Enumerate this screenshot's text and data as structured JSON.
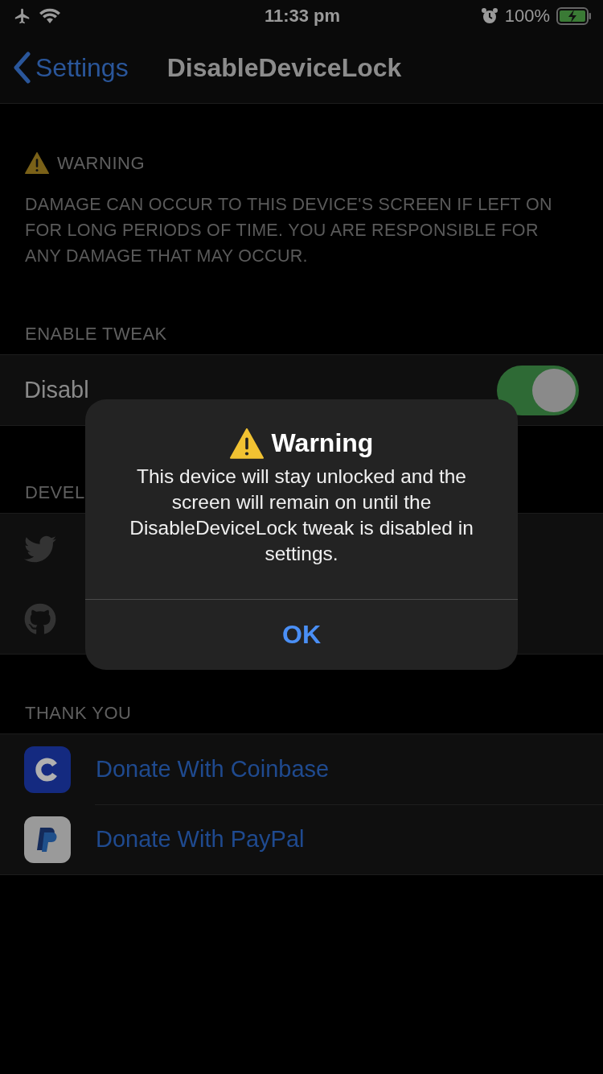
{
  "status_bar": {
    "time": "11:33 pm",
    "battery": "100%"
  },
  "nav": {
    "back": "Settings",
    "title": "DisableDeviceLock"
  },
  "sections": [
    {
      "kind": "warning",
      "header": "WARNING",
      "footer": "DAMAGE CAN OCCUR TO THIS DEVICE'S SCREEN IF LEFT ON FOR LONG PERIODS OF TIME. YOU ARE RESPONSIBLE FOR ANY DAMAGE THAT MAY OCCUR."
    },
    {
      "kind": "toggle",
      "header": "ENABLE TWEAK",
      "rows": [
        {
          "label": "Disabl",
          "on": true
        }
      ]
    },
    {
      "kind": "icons",
      "header": "DEVEL",
      "rows": [
        {
          "kind": "bird"
        },
        {
          "kind": "cat"
        }
      ]
    },
    {
      "kind": "links",
      "header": "THANK YOU",
      "rows": [
        {
          "kind": "coin",
          "label": "Donate With Coinbase"
        },
        {
          "kind": "pay",
          "label": "Donate With PayPal"
        }
      ]
    }
  ],
  "alert": {
    "title": "Warning",
    "message": "This device will stay unlocked and the screen will remain on until the DisableDeviceLock tweak is disabled in settings.",
    "button": "OK"
  }
}
